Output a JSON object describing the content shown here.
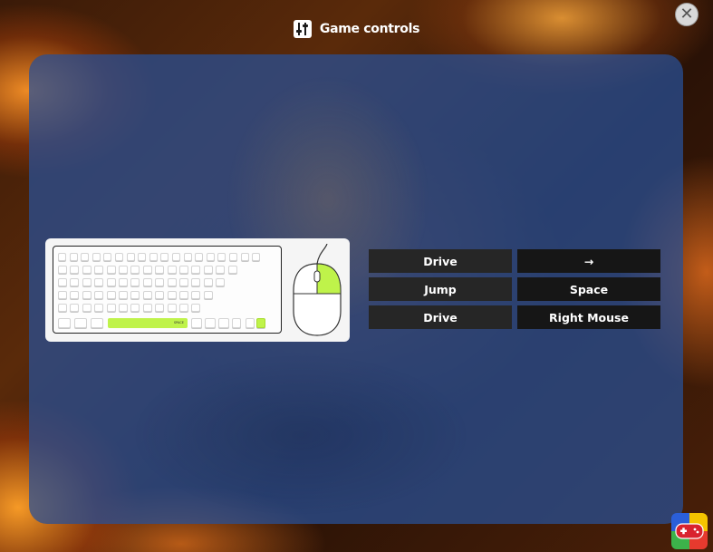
{
  "header": {
    "title": "Game controls"
  },
  "keyboard_legend": {
    "space_label": "SPACE"
  },
  "controls": [
    {
      "action": "Drive",
      "key": "→"
    },
    {
      "action": "Jump",
      "key": "Space"
    },
    {
      "action": "Drive",
      "key": "Right Mouse"
    }
  ],
  "colors": {
    "highlight": "#bff34a",
    "panel": "#2f5a9e",
    "cell": "#262626"
  },
  "icons": {
    "header": "sliders-icon",
    "close": "close-icon",
    "brand": "gamepad-logo-icon"
  }
}
